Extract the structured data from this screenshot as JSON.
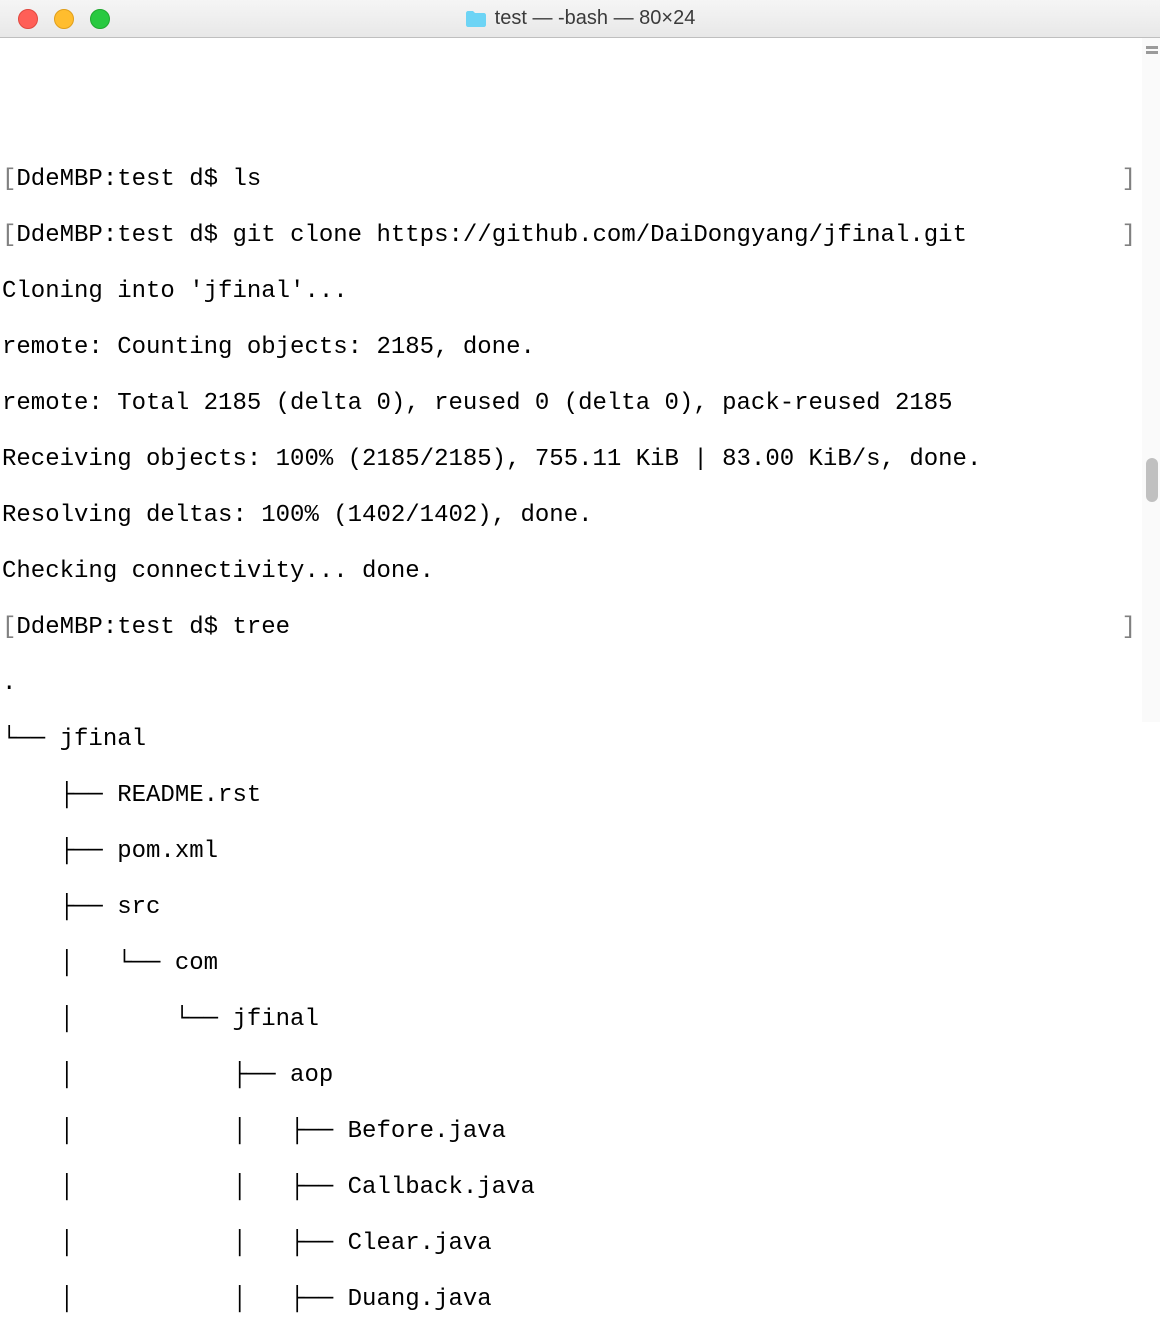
{
  "window": {
    "title": "test — -bash — 80×24"
  },
  "terminal": {
    "prompt1": "DdeMBP:test d$ ",
    "cmd1": "ls",
    "prompt2": "DdeMBP:test d$ ",
    "cmd2": "git clone https://github.com/DaiDongyang/jfinal.git",
    "out1": "Cloning into 'jfinal'...",
    "out2": "remote: Counting objects: 2185, done.",
    "out3": "remote: Total 2185 (delta 0), reused 0 (delta 0), pack-reused 2185",
    "out4": "Receiving objects: 100% (2185/2185), 755.11 KiB | 83.00 KiB/s, done.",
    "out5": "Resolving deltas: 100% (1402/1402), done.",
    "out6": "Checking connectivity... done.",
    "prompt3": "DdeMBP:test d$ ",
    "cmd3": "tree",
    "tree1": ".",
    "tree2": "└── jfinal",
    "tree3": "    ├── README.rst",
    "tree4": "    ├── pom.xml",
    "tree5": "    ├── src",
    "tree6": "    │   └── com",
    "tree7": "    │       └── jfinal",
    "tree8": "    │           ├── aop",
    "tree9": "    │           │   ├── Before.java",
    "tree10": "    │           │   ├── Callback.java",
    "tree11": "    │           │   ├── Clear.java",
    "tree12": "    │           │   ├── Duang.java"
  }
}
